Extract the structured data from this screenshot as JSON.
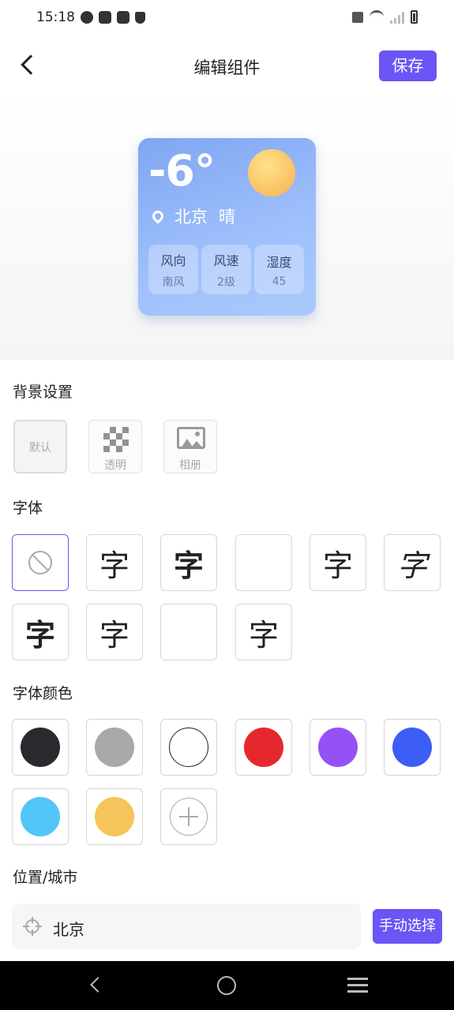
{
  "status_bar": {
    "time": "15:18"
  },
  "header": {
    "title": "编辑组件",
    "save_label": "保存"
  },
  "widget": {
    "temperature": "-6°",
    "city": "北京",
    "weather": "晴",
    "tiles": [
      {
        "label": "风向",
        "value": "南风"
      },
      {
        "label": "风速",
        "value": "2级"
      },
      {
        "label": "湿度",
        "value": "45"
      }
    ],
    "colors": {
      "gradient_start": "#7fa6f2",
      "gradient_end": "#a9c9fc"
    }
  },
  "background_settings": {
    "title": "背景设置",
    "options": [
      {
        "label": "默认",
        "icon": "none"
      },
      {
        "label": "透明",
        "icon": "checkerboard-icon"
      },
      {
        "label": "相册",
        "icon": "image-icon"
      }
    ]
  },
  "font": {
    "title": "字体",
    "options": [
      {
        "glyph": "",
        "icon": "ban-icon",
        "selected": true
      },
      {
        "glyph": "字"
      },
      {
        "glyph": "字"
      },
      {
        "glyph": ""
      },
      {
        "glyph": "字"
      },
      {
        "glyph": "字"
      },
      {
        "glyph": "字"
      },
      {
        "glyph": "字"
      },
      {
        "glyph": ""
      },
      {
        "glyph": "字"
      }
    ]
  },
  "font_color": {
    "title": "字体颜色",
    "swatches": [
      "#2a292e",
      "#a9a9ab",
      "#ffffff",
      "#e5282e",
      "#9651f6",
      "#3c5ef5",
      "#52c6f7",
      "#f5c45a"
    ],
    "add_icon": "plus-icon"
  },
  "location": {
    "title": "位置/城市",
    "city_value": "北京",
    "pick_label": "手动选择"
  },
  "theme": {
    "accent": "#6a55f5"
  }
}
